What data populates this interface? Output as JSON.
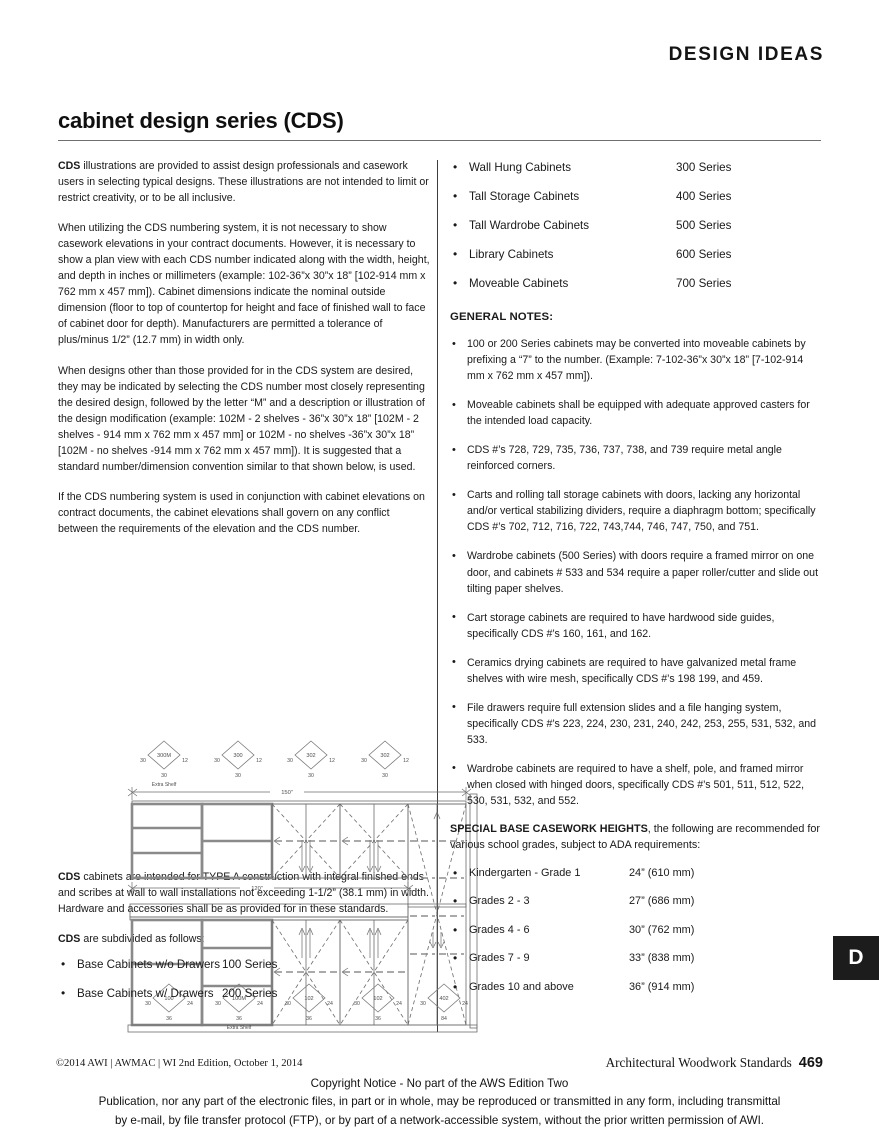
{
  "header": {
    "section_title": "DESIGN IDEAS",
    "page_heading": "cabinet design series (CDS)",
    "tab_letter": "D"
  },
  "left_column": {
    "para1_lead": "CDS",
    "para1": " illustrations are provided to assist design professionals and casework users in selecting typical designs. These illustrations are not intended to limit or restrict creativity, or to be all inclusive.",
    "para2": "When utilizing the CDS numbering system, it is not necessary to show casework elevations in your contract documents. However, it is necessary to show a plan view with each CDS number indicated along with the width, height, and depth in inches  or millimeters (example: 102-36”x 30”x 18” [102-914 mm x 762 mm x 457 mm]). Cabinet dimensions indicate the nominal outside dimension (floor to top of countertop for height and face of finished wall to face of cabinet door for depth). Manufacturers are permitted a tolerance of plus/minus 1/2” (12.7 mm) in width only.",
    "para3": "When designs other than those provided for in the CDS system are desired, they may be indicated by selecting the CDS number most closely representing the desired design, followed by the letter “M” and a description or illustration of the design modification (example: 102M - 2 shelves - 36”x 30”x 18” [102M - 2 shelves - 914 mm x 762 mm x 457 mm] or 102M - no shelves -36”x 30”x 18” [102M - no shelves -914 mm x 762 mm x 457 mm]). It is suggested that a standard number/dimension convention similar to that shown below, is used.",
    "para4": "If the CDS numbering system is used in conjunction with cabinet elevations on contract documents, the cabinet elevations shall govern on any conflict between the requirements of the elevation and the CDS number.",
    "para5_lead": "CDS",
    "para5": " cabinets are intended for TYPE A construction with integral finished ends and scribes at wall to wall installations not exceeding 1-1/2” (38.1 mm) in width.  Hardware and accessories shall be as provided for in these standards.",
    "para6_lead": "CDS",
    "para6": " are subdivided as follows:",
    "series_list": [
      {
        "label": "Base Cabinets w/o Drawers",
        "value": "100 Series"
      },
      {
        "label": "Base Cabinets w/ Drawers",
        "value": "200 Series"
      }
    ]
  },
  "right_column": {
    "series_list": [
      {
        "label": "Wall Hung Cabinets",
        "value": "300 Series"
      },
      {
        "label": "Tall Storage Cabinets",
        "value": "400 Series"
      },
      {
        "label": "Tall Wardrobe Cabinets",
        "value": "500 Series"
      },
      {
        "label": "Library Cabinets",
        "value": "600 Series"
      },
      {
        "label": "Moveable Cabinets",
        "value": "700 Series"
      }
    ],
    "general_notes_heading": "GENERAL NOTES:",
    "general_notes": [
      "100 or 200 Series cabinets may be converted into moveable cabinets by prefixing a “7” to the number. (Example: 7-102-36”x 30”x 18” [7-102-914 mm x 762 mm x 457 mm]).",
      "Moveable cabinets shall be equipped with adequate approved casters for the intended load capacity.",
      "CDS #’s 728, 729, 735, 736, 737, 738, and 739 require metal angle reinforced corners.",
      "Carts and rolling tall storage cabinets with doors, lacking any horizontal and/or vertical stabilizing dividers, require a diaphragm bottom; specifically CDS #’s 702, 712, 716, 722, 743,744, 746, 747, 750, and 751.",
      "Wardrobe cabinets (500 Series) with doors require a framed mirror on one door, and cabinets # 533 and 534 require a paper roller/cutter and slide out tilting paper shelves.",
      "Cart storage cabinets are required to have hardwood side guides, specifically CDS #’s 160, 161, and 162.",
      "Ceramics drying cabinets are required to have galvanized metal frame shelves with wire mesh, specifically CDS #’s 198 199, and 459.",
      "File drawers require full extension slides and a file hanging system, specifically CDS #’s 223, 224, 230, 231, 240, 242, 253, 255, 531, 532, and 533.",
      "Wardrobe cabinets are required to have a shelf, pole, and framed mirror when closed with hinged doors, specifically CDS #’s 501, 511, 512, 522, 530, 531, 532, and 552."
    ],
    "special_heading_bold": "SPECIAL BASE CASEWORK HEIGHTS",
    "special_heading_rest": ", the following are recommended for various school grades, subject to ADA requirements:",
    "heights_list": [
      {
        "label": "Kindergarten - Grade 1",
        "value": "24” (610 mm)"
      },
      {
        "label": "Grades 2 - 3",
        "value": "27” (686 mm)"
      },
      {
        "label": "Grades 4 - 6",
        "value": "30” (762 mm)"
      },
      {
        "label": "Grades 7 - 9",
        "value": "33” (838 mm)"
      },
      {
        "label": "Grades 10 and above",
        "value": "36” (914 mm)"
      }
    ]
  },
  "drawing": {
    "top_dimension": "150”",
    "middle_dimension": "120”",
    "upper_tags": [
      {
        "code": "300M",
        "left": "30",
        "right": "12",
        "bottom": "30",
        "note": "Extra Shelf"
      },
      {
        "code": "300",
        "left": "30",
        "right": "12",
        "bottom": "30",
        "note": ""
      },
      {
        "code": "302",
        "left": "30",
        "right": "12",
        "bottom": "30",
        "note": ""
      },
      {
        "code": "302",
        "left": "30",
        "right": "12",
        "bottom": "30",
        "note": ""
      }
    ],
    "lower_tags": [
      {
        "code": "100",
        "left": "30",
        "right": "24",
        "bottom": "36",
        "note": ""
      },
      {
        "code": "100M",
        "left": "30",
        "right": "24",
        "bottom": "36",
        "note": "Extra Shelf"
      },
      {
        "code": "102",
        "left": "30",
        "right": "24",
        "bottom": "36",
        "note": ""
      },
      {
        "code": "102",
        "left": "30",
        "right": "24",
        "bottom": "36",
        "note": ""
      },
      {
        "code": "402",
        "left": "30",
        "right": "24",
        "bottom": "84",
        "note": ""
      }
    ]
  },
  "footer": {
    "left": "©2014 AWI | AWMAC | WI  2nd Edition, October 1, 2014",
    "right_title": "Architectural Woodwork Standards",
    "page_number": "469",
    "copyright_line1": "Copyright Notice - No part of the AWS Edition Two",
    "copyright_line2": "Publication, nor any part of the electronic files, in part or in whole, may be reproduced or transmitted in any form, including transmittal",
    "copyright_line3": "by e-mail, by file transfer protocol (FTP), or by part of a network-accessible system, without the prior written permission of AWI."
  }
}
